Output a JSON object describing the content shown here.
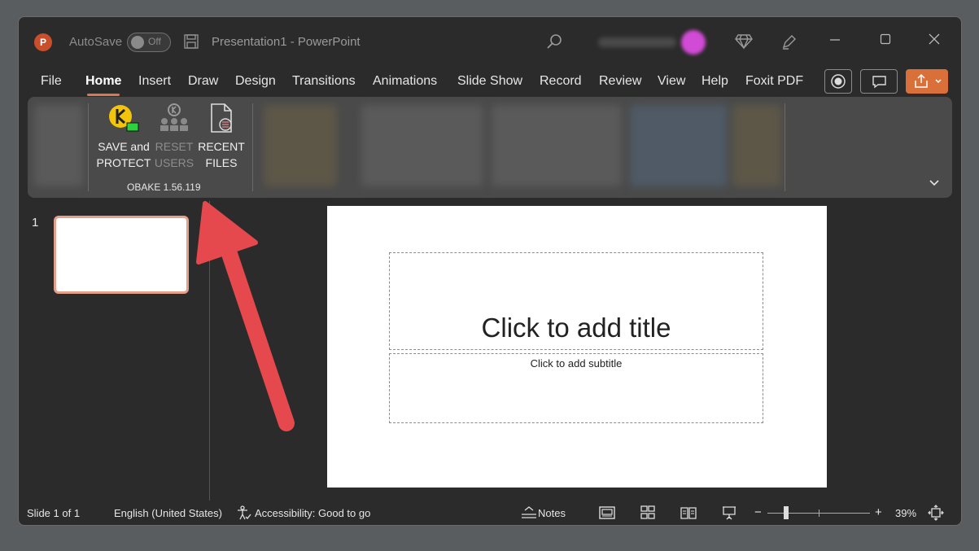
{
  "titlebar": {
    "app_icon_letter": "P",
    "autosave_label": "AutoSave",
    "autosave_state": "Off",
    "document_title": "Presentation1 - PowerPoint"
  },
  "tabs": [
    "File",
    "Home",
    "Insert",
    "Draw",
    "Design",
    "Transitions",
    "Animations",
    "Slide Show",
    "Record",
    "Review",
    "View",
    "Help",
    "Foxit PDF"
  ],
  "active_tab": "Home",
  "ribbon": {
    "obake_group_label": "OBAKE 1.56.119",
    "buttons": [
      {
        "line1": "SAVE and",
        "line2": "PROTECT",
        "enabled": true
      },
      {
        "line1": "RESET",
        "line2": "USERS",
        "enabled": false
      },
      {
        "line1": "RECENT",
        "line2": "FILES",
        "enabled": true
      }
    ]
  },
  "slides_panel": {
    "slide_number": "1"
  },
  "slide": {
    "title_placeholder": "Click to add title",
    "subtitle_placeholder": "Click to add subtitle"
  },
  "statusbar": {
    "slide_position": "Slide 1 of 1",
    "language": "English (United States)",
    "accessibility": "Accessibility: Good to go",
    "notes": "Notes",
    "zoom_minus": "−",
    "zoom_plus": "+",
    "zoom_percent": "39%"
  },
  "colors": {
    "accent": "#d97850",
    "share_button": "#d9703a",
    "annotation_arrow": "#e5484d",
    "obake_icon": "#f2c40c"
  }
}
